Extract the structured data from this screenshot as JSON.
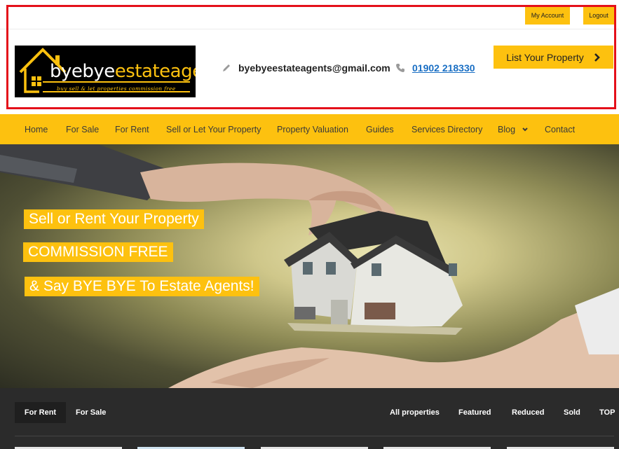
{
  "topbar": {
    "my_account": "My Account",
    "logout": "Logout"
  },
  "header": {
    "logo": {
      "word_part1": "byebye",
      "word_part2": "estateagents",
      "tagline": "buy sell & let properties commission free"
    },
    "email": "byebyeestateagents@gmail.com",
    "email_icon": "pencil-icon",
    "phone": "01902 218330",
    "phone_icon": "phone-icon",
    "cta": {
      "label": "List Your Property",
      "icon": "chevron-right-icon"
    }
  },
  "nav": {
    "items": [
      {
        "label": "Home"
      },
      {
        "label": "For Sale"
      },
      {
        "label": "For Rent"
      },
      {
        "label": "Sell or Let Your Property"
      },
      {
        "label": "Property Valuation"
      },
      {
        "label": "Guides"
      },
      {
        "label": "Services Directory"
      },
      {
        "label": "Blog",
        "icon": "caret-down-icon"
      },
      {
        "label": "Contact"
      }
    ]
  },
  "hero": {
    "line1": "Sell or Rent Your Property",
    "line2": "COMMISSION FREE",
    "line3": "& Say BYE BYE To Estate Agents!"
  },
  "listing": {
    "tabs": [
      "For Rent",
      "For Sale"
    ],
    "active_tab": "For Rent",
    "filters": [
      "All properties",
      "Featured",
      "Reduced",
      "Sold",
      "TOP"
    ]
  },
  "colors": {
    "accent": "#fdc10f",
    "highlight_frame": "#e4101a",
    "dark_band": "#2b2b2b",
    "link": "#1a6fc4"
  }
}
